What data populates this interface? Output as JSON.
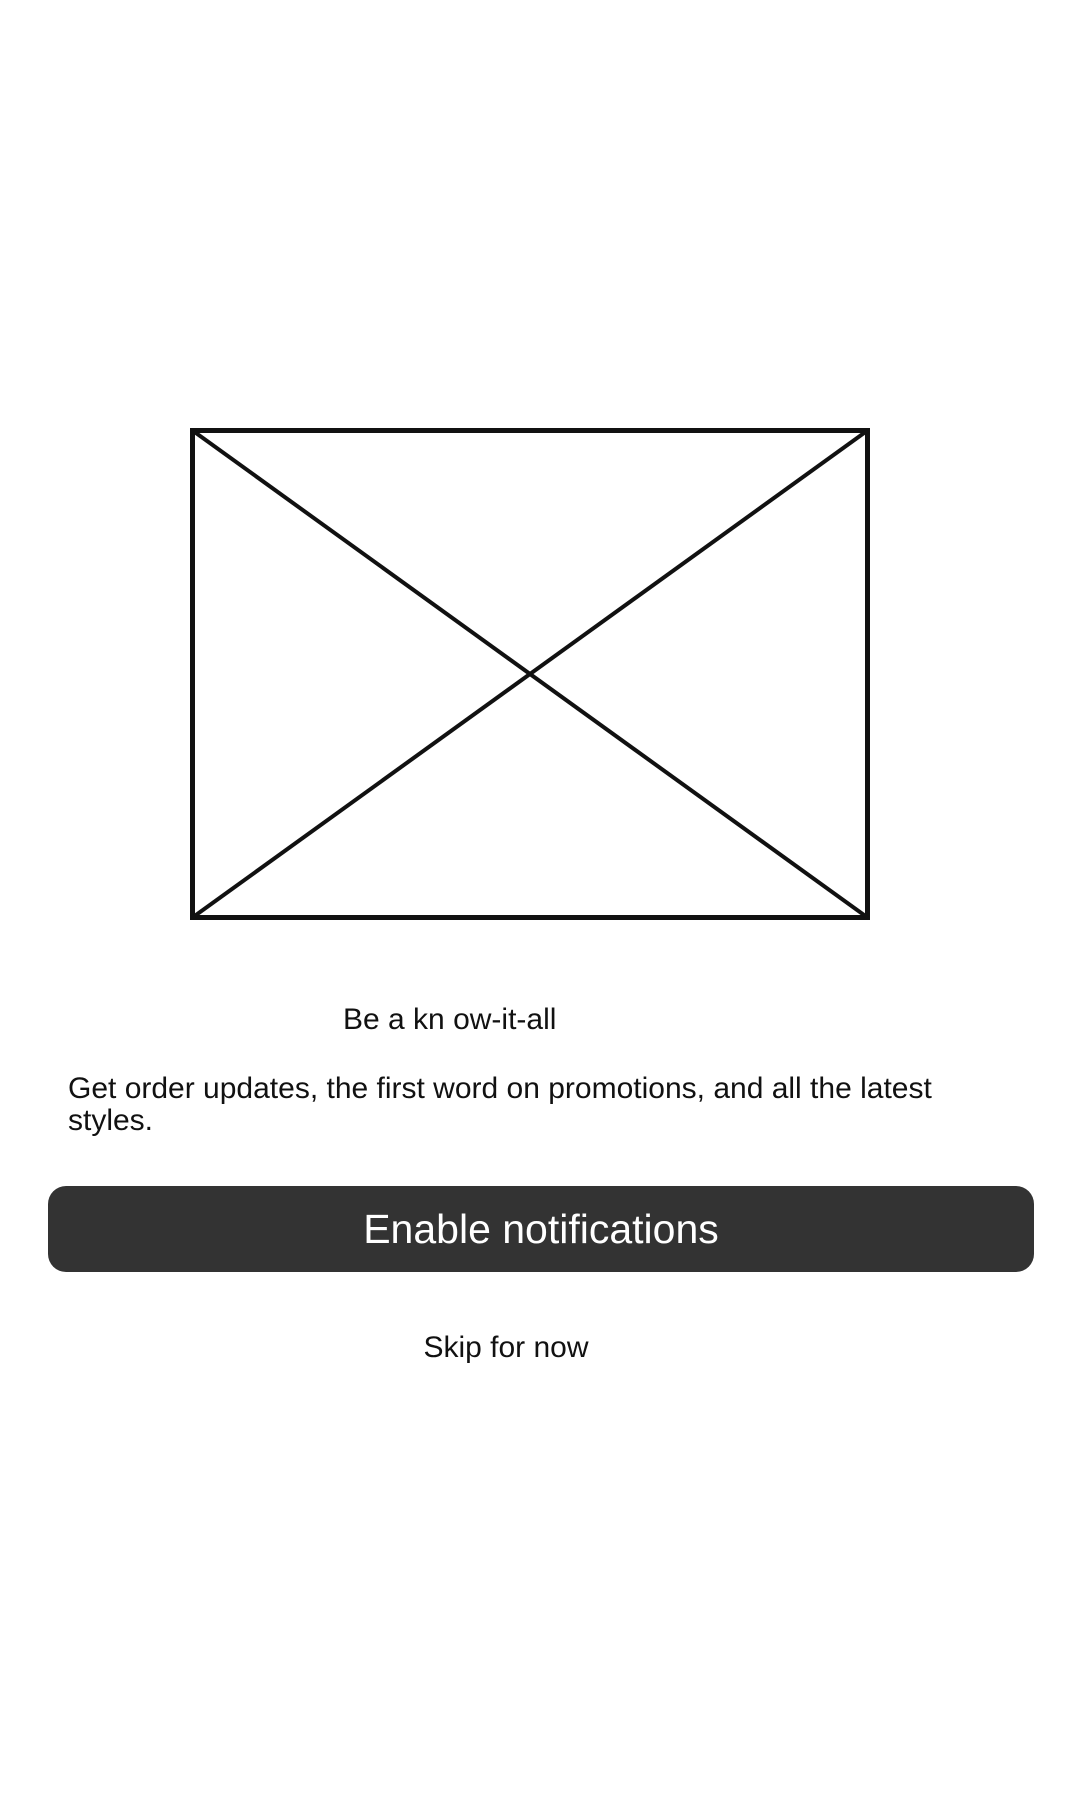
{
  "onboarding": {
    "image_icon": "image-placeholder-icon",
    "headline": "Be a kn ow-it-all",
    "description": "Get order updates, the first word on promotions, and all the latest styles.",
    "enable_button_label": "Enable notifications",
    "skip_label": "Skip for now"
  },
  "colors": {
    "background": "#ffffff",
    "text": "#111111",
    "button_background": "#333333",
    "button_text": "#ffffff",
    "placeholder_stroke": "#111111"
  }
}
